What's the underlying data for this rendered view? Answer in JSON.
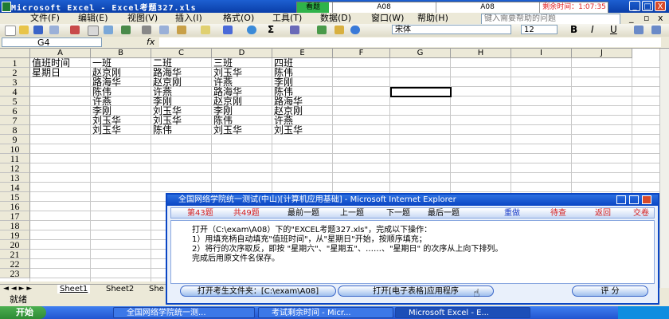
{
  "app": {
    "title": "Microsoft Excel - Excel考题327.xls",
    "window_controls": [
      "_",
      "□",
      "X"
    ]
  },
  "timer": {
    "tab_label": "看题",
    "folder1": "A08",
    "folder2": "A08",
    "remaining_label": "剩余时间：1:07:35",
    "colors": {
      "tab": "#2fb34a",
      "remaining": "#e02020"
    }
  },
  "menubar": {
    "items": [
      "文件(F)",
      "编辑(E)",
      "视图(V)",
      "插入(I)",
      "格式(O)",
      "工具(T)",
      "数据(D)",
      "窗口(W)",
      "帮助(H)"
    ],
    "help_placeholder": "键入需要帮助的问题"
  },
  "toolbar": {
    "font_name": "宋体",
    "font_size": "12",
    "bold": "B",
    "italic": "I",
    "underline": "U",
    "sigma": "Σ"
  },
  "formula_bar": {
    "name_box": "G4",
    "fx": "fx",
    "content": ""
  },
  "grid": {
    "columns": [
      "A",
      "B",
      "C",
      "D",
      "E",
      "F",
      "G",
      "H",
      "I",
      "J"
    ],
    "rows": [
      "1",
      "2",
      "3",
      "4",
      "5",
      "6",
      "7",
      "8",
      "9",
      "10",
      "11",
      "12",
      "13",
      "14",
      "15",
      "16",
      "17",
      "18",
      "19",
      "20",
      "21",
      "22",
      "23"
    ],
    "cells": [
      [
        "值班时间",
        "一班",
        "二班",
        "三班",
        "四班"
      ],
      [
        "星期日",
        "赵京刚",
        "路海华",
        "刘玉华",
        "陈伟"
      ],
      [
        "",
        "路海华",
        "赵京刚",
        "许燕",
        "李刚"
      ],
      [
        "",
        "陈伟",
        "许燕",
        "路海华",
        "陈伟"
      ],
      [
        "",
        "许燕",
        "李刚",
        "赵京刚",
        "路海华"
      ],
      [
        "",
        "李刚",
        "刘玉华",
        "李刚",
        "赵京刚"
      ],
      [
        "",
        "刘玉华",
        "刘玉华",
        "陈伟",
        "许燕"
      ],
      [
        "",
        "刘玉华",
        "陈伟",
        "刘玉华",
        "刘玉华"
      ]
    ],
    "selected_cell": "G4"
  },
  "sheets": [
    "Sheet1",
    "Sheet2",
    "She"
  ],
  "status": {
    "text": "就绪"
  },
  "taskbar": {
    "start": "开始",
    "tasks": [
      "全国网络学院统一测...",
      "考试剩余时间 - Micr...",
      "Microsoft Excel - E..."
    ]
  },
  "dialog": {
    "title": "全国网络学院统一测试(中山)[计算机应用基础] - Microsoft Internet Explorer",
    "nav": {
      "current": "第43题",
      "total": "共49题",
      "prev_first": "最前一题",
      "prev": "上一题",
      "next": "下一题",
      "last": "最后一题",
      "redo": "重做",
      "review": "待查",
      "back": "返回",
      "submit": "交卷"
    },
    "body": [
      "打开（C:\\exam\\A08）下的\"EXCEL考题327.xls\"，完成以下操作：",
      "1）用填充柄自动填充\"值班时间\"，从\"星期日\"开始，按顺序填充；",
      "2）将行的次序取反，即按 \"星期六\"、\"星期五\"、……、\"星期日\" 的次序从上向下排列。",
      "完成后用原文件名保存。"
    ],
    "btn_open_folder": "打开考生文件夹：[C:\\exam\\A08]",
    "btn_open_app": "打开[电子表格]应用程序",
    "btn_score": "评 分",
    "colors": {
      "redo": "#1e3fc9",
      "review": "#d42020",
      "back": "#d42020",
      "submit": "#d42020",
      "counter": "#d42020"
    }
  }
}
